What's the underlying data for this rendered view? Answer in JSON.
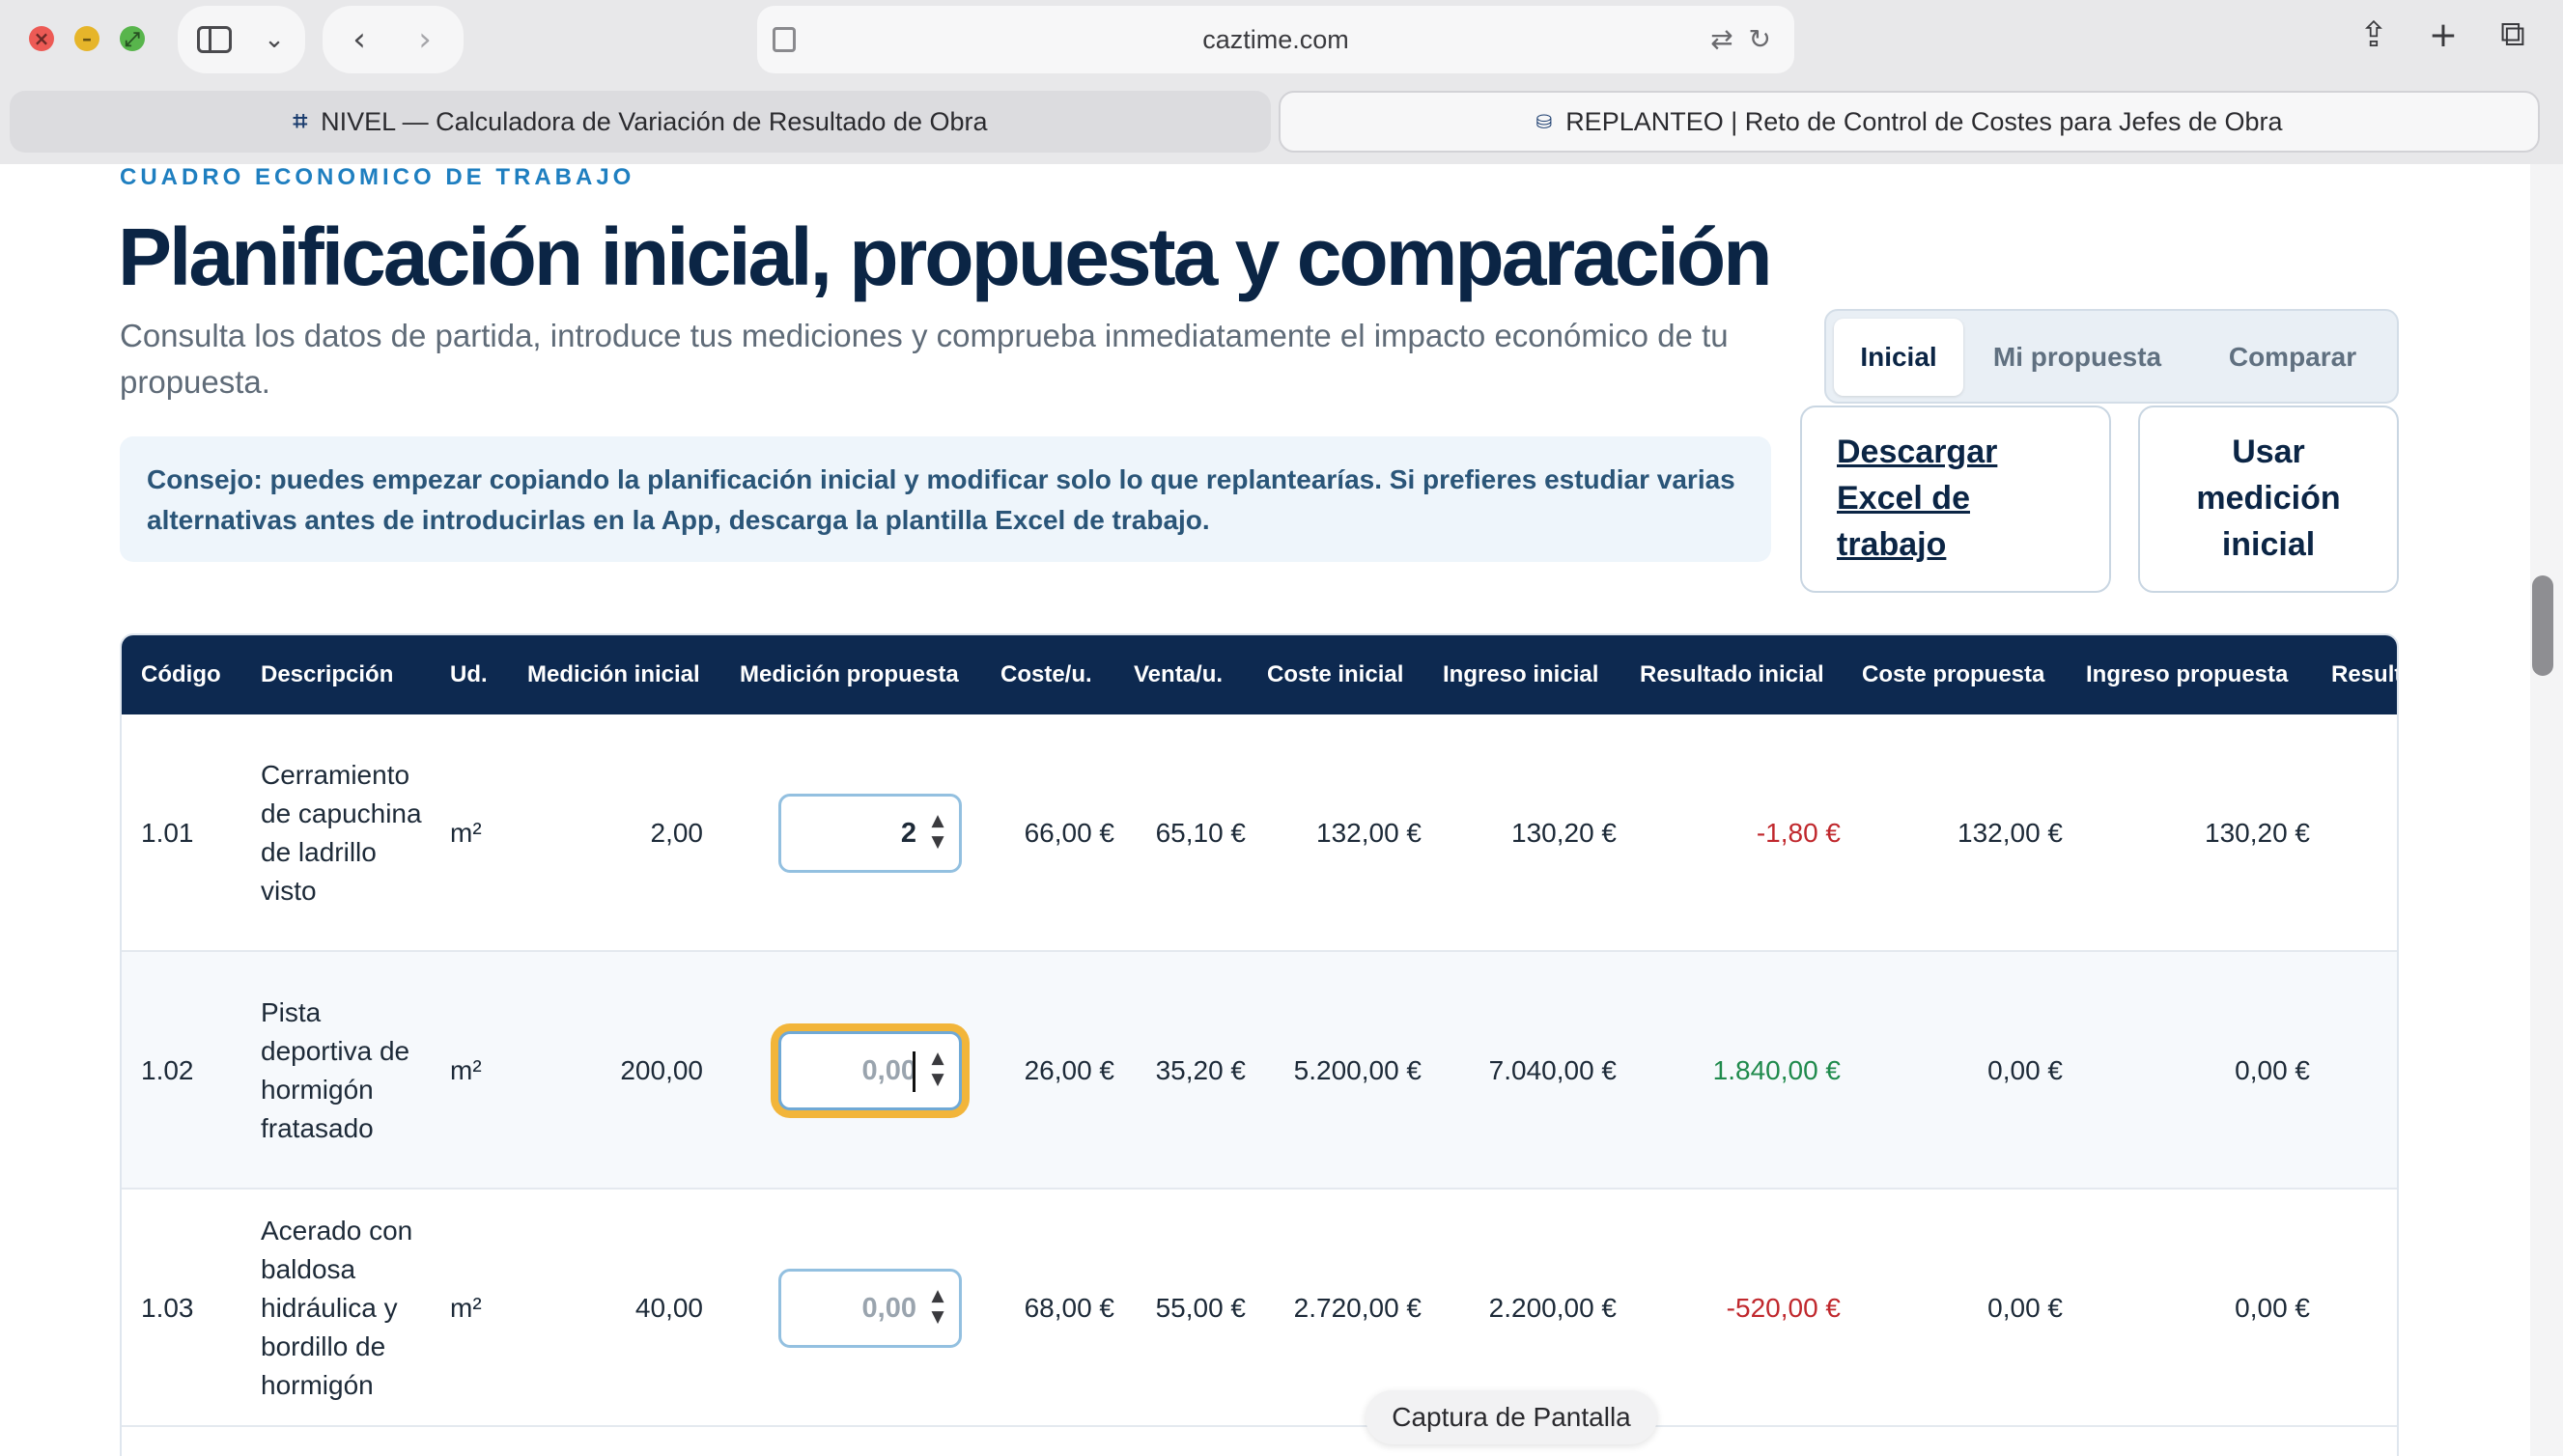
{
  "browser": {
    "url": "caztime.com",
    "tabs": [
      {
        "label": "NIVEL — Calculadora de Variación de Resultado de Obra",
        "icon": "nivel-icon"
      },
      {
        "label": "REPLANTEO | Reto de Control de Costes para Jefes de Obra",
        "icon": "replanteo-icon"
      }
    ]
  },
  "header": {
    "eyebrow": "CUADRO ECONOMICO DE TRABAJO",
    "title": "Planificación inicial, propuesta y comparación",
    "subtitle": "Consulta los datos de partida, introduce tus mediciones y comprueba inmediatamente el impacto económico de tu propuesta."
  },
  "view_switch": {
    "options": [
      "Inicial",
      "Mi propuesta",
      "Comparar"
    ],
    "selected": "Inicial"
  },
  "actions": {
    "download_excel": "Descargar Excel de trabajo",
    "use_initial": "Usar medición inicial"
  },
  "tip": "Consejo: puedes empezar copiando la planificación inicial y modificar solo lo que replantearías. Si prefieres estudiar varias alternativas antes de introducirlas en la App, descarga la plantilla Excel de trabajo.",
  "table": {
    "columns": [
      "Código",
      "Descripción",
      "Ud.",
      "Medición inicial",
      "Medición propuesta",
      "Coste/u.",
      "Venta/u.",
      "Coste inicial",
      "Ingreso inicial",
      "Resultado inicial",
      "Coste propuesta",
      "Ingreso propuesta",
      "Result"
    ],
    "rows": [
      {
        "code": "1.01",
        "description": "Cerramiento de capuchina de ladrillo visto",
        "unit": "m²",
        "initial_qty": "2,00",
        "proposed_qty": "2",
        "proposed_placeholder": "0,00",
        "cost_unit": "66,00 €",
        "sale_unit": "65,10 €",
        "cost_initial": "132,00 €",
        "income_initial": "130,20 €",
        "result_initial": "-1,80 €",
        "result_sign": "negative",
        "cost_proposed": "132,00 €",
        "income_proposed": "130,20 €"
      },
      {
        "code": "1.02",
        "description": "Pista deportiva de hormigón fratasado",
        "unit": "m²",
        "initial_qty": "200,00",
        "proposed_qty": "",
        "proposed_placeholder": "0,00",
        "cost_unit": "26,00 €",
        "sale_unit": "35,20 €",
        "cost_initial": "5.200,00 €",
        "income_initial": "7.040,00 €",
        "result_initial": "1.840,00 €",
        "result_sign": "positive",
        "cost_proposed": "0,00 €",
        "income_proposed": "0,00 €"
      },
      {
        "code": "1.03",
        "description": "Acerado con baldosa hidráulica y bordillo de hormigón",
        "unit": "m²",
        "initial_qty": "40,00",
        "proposed_qty": "",
        "proposed_placeholder": "0,00",
        "cost_unit": "68,00 €",
        "sale_unit": "55,00 €",
        "cost_initial": "2.720,00 €",
        "income_initial": "2.200,00 €",
        "result_initial": "-520,00 €",
        "result_sign": "negative",
        "cost_proposed": "0,00 €",
        "income_proposed": "0,00 €"
      }
    ]
  },
  "toast": "Captura de Pantalla",
  "colors": {
    "header_bg": "#0d2950",
    "accent": "#1f7fc0",
    "negative": "#c0282d",
    "positive": "#1f8a4c",
    "focus_ring": "#f2b53a"
  }
}
